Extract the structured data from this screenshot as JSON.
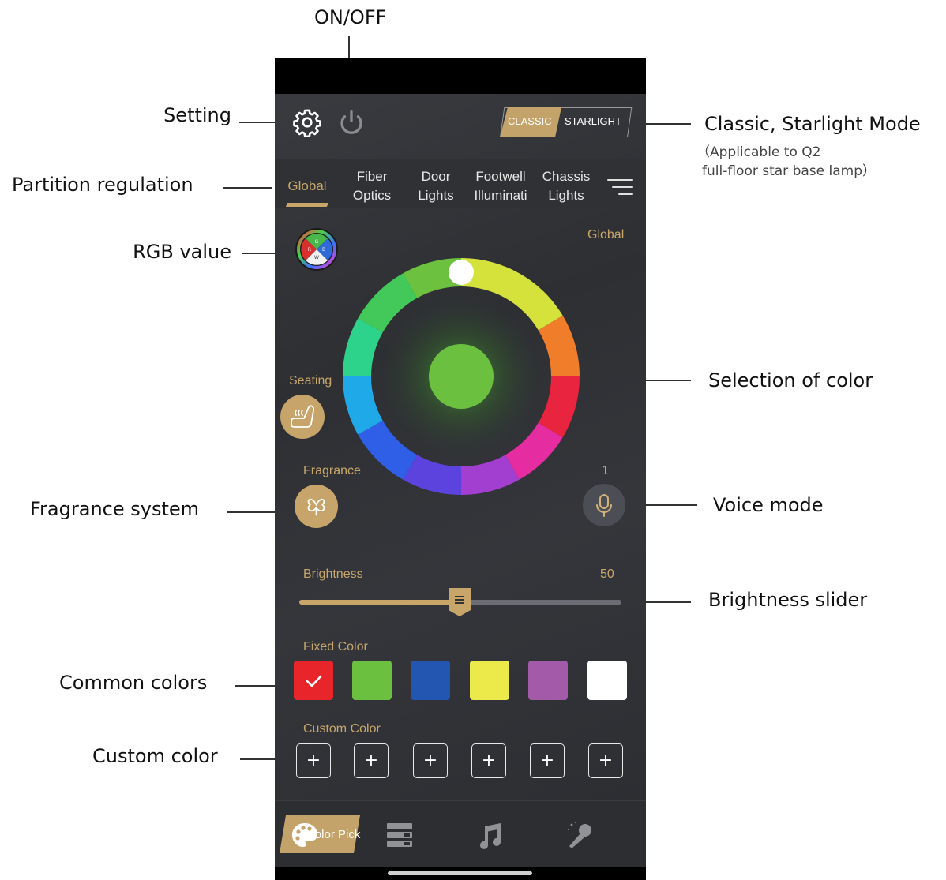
{
  "annotations": {
    "on_off": "ON/OFF",
    "setting": "Setting",
    "partition": "Partition regulation",
    "rgb": "RGB value",
    "fragrance": "Fragrance system",
    "common_colors": "Common colors",
    "custom_color": "Custom color",
    "classic_starlight": "Classic, Starlight Mode",
    "classic_note_1": "（Applicable to Q2",
    "classic_note_2": "full-floor star base lamp）",
    "selection": "Selection of color",
    "voice": "Voice mode",
    "brightness": "Brightness slider"
  },
  "app": {
    "icons": {
      "settings": "gear-icon",
      "power": "power-icon"
    },
    "mode_switch": {
      "classic": "CLASSIC",
      "starlight": "STARLIGHT",
      "active": "CLASSIC"
    },
    "tabs": [
      {
        "label": "Global"
      },
      {
        "label": "Fiber\nOptics"
      },
      {
        "label": "Door\nLights"
      },
      {
        "label": "Footwell\nIlluminati"
      },
      {
        "label": "Chassis\nLights"
      }
    ],
    "zone_label": "Global",
    "selected_color": "#6cc040",
    "seating_label": "Seating",
    "fragrance_label": "Fragrance",
    "voice_value": "1",
    "brightness": {
      "label": "Brightness",
      "value": "50",
      "fraction": 0.5
    },
    "fixed_color_label": "Fixed Color",
    "fixed_colors": [
      "#e8252b",
      "#6cc040",
      "#2256b0",
      "#ece94b",
      "#a35aa8",
      "#ffffff"
    ],
    "fixed_selected_index": 0,
    "custom_color_label": "Custom Color",
    "custom_slots": [
      "+",
      "+",
      "+",
      "+",
      "+",
      "+"
    ],
    "nav": {
      "active_label": "Color Pick",
      "items": [
        "palette-icon",
        "list-icon",
        "music-icon",
        "microphone-icon"
      ]
    },
    "accent": "#c8a66a"
  }
}
